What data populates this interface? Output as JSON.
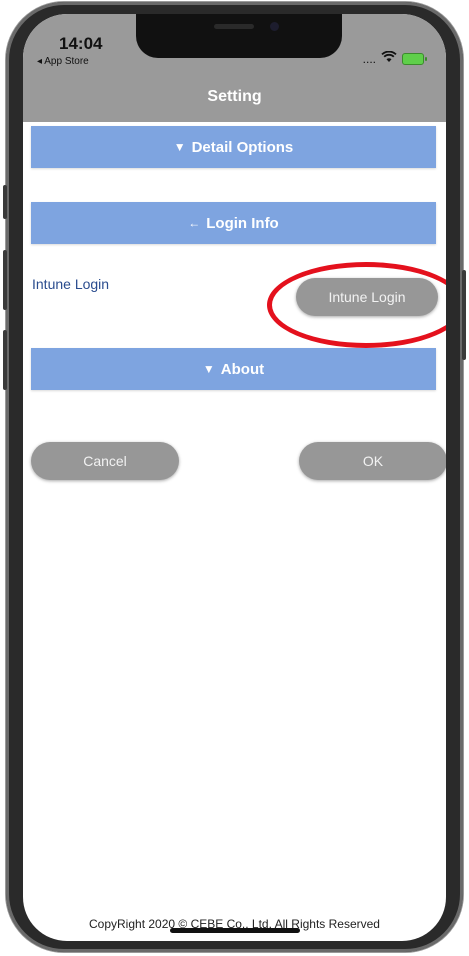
{
  "status_bar": {
    "time": "14:04",
    "back_app": "◂ App Store",
    "signal": "....",
    "wifi": "wifi-icon",
    "battery": "battery-icon"
  },
  "nav": {
    "title": "Setting"
  },
  "sections": {
    "detail_options": {
      "arrow": "▼",
      "label": "Detail Options"
    },
    "login_info": {
      "arrow": "←",
      "label": "Login Info"
    },
    "about": {
      "arrow": "▼",
      "label": "About"
    }
  },
  "login": {
    "row_label": "Intune Login",
    "button_label": "Intune Login"
  },
  "actions": {
    "cancel_label": "Cancel",
    "ok_label": "OK"
  },
  "footer": {
    "copyright": "CopyRight 2020 © CEBE Co., Ltd. All Rights Reserved"
  },
  "colors": {
    "section_bar": "#7ea4e0",
    "nav_bar": "#9a9a9a",
    "button": "#979797",
    "highlight": "#e4111d",
    "label_text": "#2a4c8e"
  }
}
